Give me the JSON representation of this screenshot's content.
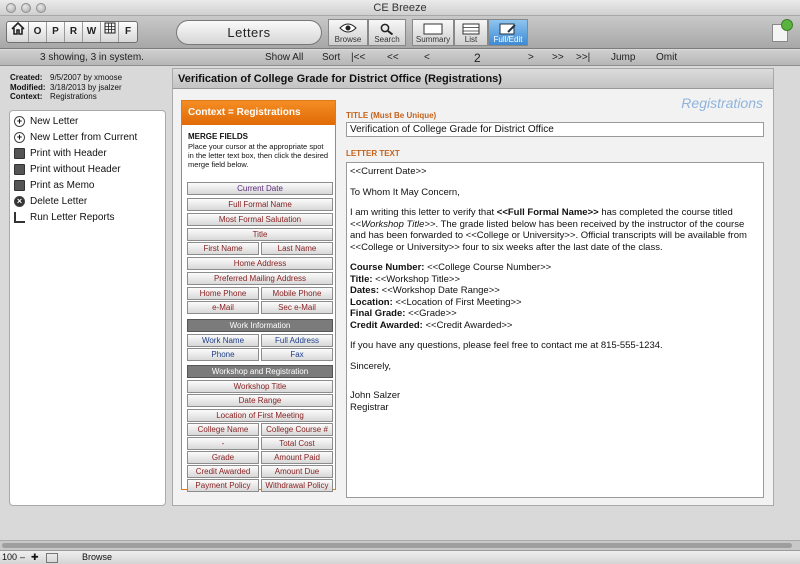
{
  "window": {
    "title": "CE Breeze"
  },
  "toolbar": {
    "nav_buttons": [
      "O",
      "P",
      "R",
      "W",
      "F"
    ],
    "layout_name": "Letters",
    "tools": [
      {
        "label": "Browse",
        "icon": "eye-icon"
      },
      {
        "label": "Search",
        "icon": "magnifier-icon"
      },
      {
        "label": "Summary",
        "icon": "summary-icon"
      },
      {
        "label": "List",
        "icon": "list-icon"
      },
      {
        "label": "Full/Edit",
        "icon": "edit-icon",
        "active": true
      }
    ]
  },
  "recbar": {
    "found": "3 showing, 3 in system.",
    "show_all": "Show All",
    "sort": "Sort",
    "first": "|<<",
    "prev_block": "<<",
    "prev": "<",
    "current": "2",
    "next": ">",
    "next_block": ">>",
    "last": ">>|",
    "jump": "Jump",
    "omit": "Omit"
  },
  "meta": {
    "created_label": "Created:",
    "created_value": "9/5/2007 by xmoose",
    "modified_label": "Modified:",
    "modified_value": "3/18/2013 by jsalzer",
    "context_label": "Context:",
    "context_value": "Registrations"
  },
  "actions": [
    {
      "label": "New Letter",
      "icon": "plus-circle-icon"
    },
    {
      "label": "New Letter from Current",
      "icon": "plus-circle-icon"
    },
    {
      "label": "Print with Header",
      "icon": "printer-icon"
    },
    {
      "label": "Print without Header",
      "icon": "printer-icon"
    },
    {
      "label": "Print as Memo",
      "icon": "printer-icon"
    },
    {
      "label": "Delete Letter",
      "icon": "x-circle-icon"
    },
    {
      "label": "Run Letter Reports",
      "icon": "bar-chart-icon"
    }
  ],
  "main": {
    "title": "Verification of College Grade for District Office (Registrations)",
    "brand": "Registrations",
    "context_header": "Context = Registrations",
    "merge_header": "MERGE FIELDS",
    "merge_desc": "Place your cursor at the appropriate spot in the letter text box, then click the desired merge field below.",
    "fields": {
      "current_date": "Current Date",
      "full_formal_name": "Full Formal Name",
      "most_formal_salutation": "Most Formal Salutation",
      "title": "Title",
      "first_name": "First Name",
      "last_name": "Last Name",
      "home_address": "Home Address",
      "preferred_mailing_address": "Preferred Mailing Address",
      "home_phone": "Home Phone",
      "mobile_phone": "Mobile Phone",
      "email": "e-Mail",
      "sec_email": "Sec e-Mail",
      "work_info_section": "Work Information",
      "work_name": "Work Name",
      "full_address": "Full Address",
      "phone": "Phone",
      "fax": "Fax",
      "workshop_section": "Workshop and Registration",
      "workshop_title": "Workshop Title",
      "date_range": "Date Range",
      "location_first_meeting": "Location of First Meeting",
      "college_name": "College Name",
      "college_course": "College Course #",
      "dash": "-",
      "total_cost": "Total Cost",
      "grade": "Grade",
      "amount_paid": "Amount Paid",
      "credit_awarded": "Credit Awarded",
      "amount_due": "Amount Due",
      "payment_policy": "Payment Policy",
      "withdrawal_policy": "Withdrawal Policy"
    },
    "title_label": "TITLE (Must Be Unique)",
    "title_value": "Verification of College Grade for District Office",
    "text_label": "LETTER TEXT",
    "letter": {
      "date": "<<Current Date>>",
      "salutation": "To Whom It May Concern,",
      "p1_a": "I am writing this letter to verify that ",
      "p1_name": "<<Full Formal Name>>",
      "p1_b": " has completed the course titled ",
      "p1_title": "<<Workshop Title>>",
      "p1_c": ".  The grade listed below has been received by the instructor of the course and has been forwarded to <<College or University>>.  Official transcripts will be available from <<College or University>> four to six weeks after the last date of the class.",
      "course_label": "Course Number:",
      "course_value": "  <<College Course Number>>",
      "title_label": "Title:",
      "title_value": "  <<Workshop Title>>",
      "dates_label": "Dates:",
      "dates_value": "  <<Workshop Date Range>>",
      "location_label": "Location:",
      "location_value": "  <<Location of First Meeting>>",
      "grade_label": "Final Grade:",
      "grade_value": "  <<Grade>>",
      "credit_label": "Credit Awarded:",
      "credit_value": "  <<Credit Awarded>>",
      "contact": "If you have any questions, please feel free to contact me at 815-555-1234.",
      "closing": "Sincerely,",
      "signer": "John Salzer",
      "signer_title": "Registrar"
    }
  },
  "status": {
    "zoom": "100",
    "mode": "Browse"
  }
}
